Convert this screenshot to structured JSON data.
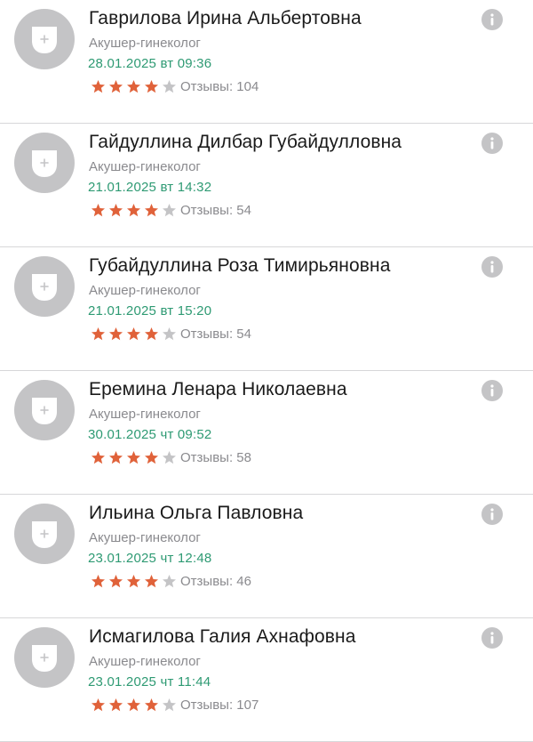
{
  "colors": {
    "accent_date": "#2e9a73",
    "star_filled": "#e0623a",
    "star_empty": "#c4c4c6",
    "avatar_bg": "#c4c4c6"
  },
  "doctors": [
    {
      "name": "Гаврилова Ирина Альбертовна",
      "specialty": "Акушер-гинеколог",
      "next_slot": "28.01.2025 вт 09:36",
      "rating": 4,
      "rating_max": 5,
      "reviews_label": "Отзывы: 104"
    },
    {
      "name": "Гайдуллина Дилбар Губайдулловна",
      "specialty": "Акушер-гинеколог",
      "next_slot": "21.01.2025 вт 14:32",
      "rating": 4,
      "rating_max": 5,
      "reviews_label": "Отзывы: 54"
    },
    {
      "name": "Губайдуллина Роза Тимирьяновна",
      "specialty": "Акушер-гинеколог",
      "next_slot": "21.01.2025 вт 15:20",
      "rating": 4,
      "rating_max": 5,
      "reviews_label": "Отзывы: 54"
    },
    {
      "name": "Еремина Ленара Николаевна",
      "specialty": "Акушер-гинеколог",
      "next_slot": "30.01.2025 чт 09:52",
      "rating": 4,
      "rating_max": 5,
      "reviews_label": "Отзывы: 58"
    },
    {
      "name": "Ильина Ольга Павловна",
      "specialty": "Акушер-гинеколог",
      "next_slot": "23.01.2025 чт 12:48",
      "rating": 4,
      "rating_max": 5,
      "reviews_label": "Отзывы: 46"
    },
    {
      "name": "Исмагилова Галия Ахнафовна",
      "specialty": "Акушер-гинеколог",
      "next_slot": "23.01.2025 чт 11:44",
      "rating": 4,
      "rating_max": 5,
      "reviews_label": "Отзывы: 107"
    }
  ],
  "icons": {
    "avatar": "person-placeholder-icon",
    "info": "info-icon",
    "star": "star-icon"
  }
}
